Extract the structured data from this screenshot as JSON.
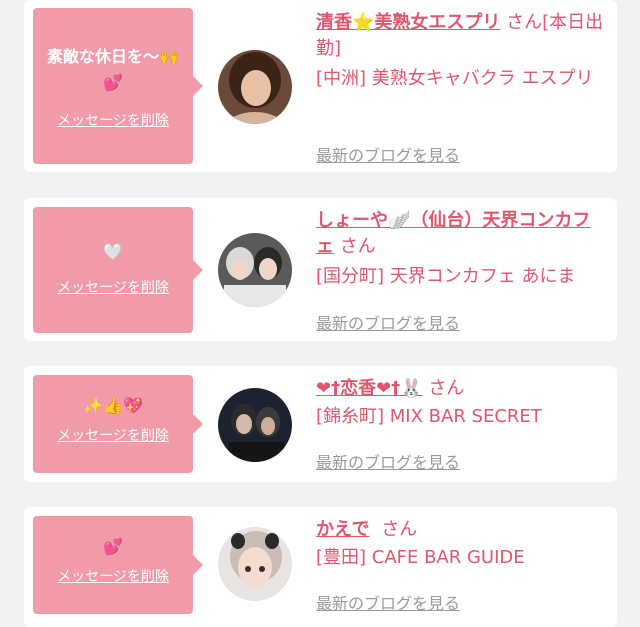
{
  "colors": {
    "accent": "#e0566e",
    "bubble": "#f19aa8",
    "muted": "#9a9a9a"
  },
  "delete_label": "メッセージを削除",
  "blog_label": "最新のブログを見る",
  "san": "さん",
  "cards": [
    {
      "message_line1": "素敵な休日を〜🙌",
      "message_line2": "💕",
      "name": "清香⭐美熟女エスプリ",
      "suffix": "[本日出勤]",
      "shop": "[中洲] 美熟女キャバクラ エスプリ"
    },
    {
      "message_line1": "🤍",
      "name": "しょーや🪽（仙台）天界コンカフェ",
      "shop": "[国分町] 天界コンカフェ あにま"
    },
    {
      "message_line1": "✨👍💖",
      "name": "❤†恋香❤†🐰",
      "shop": "[錦糸町] MIX BAR SECRET"
    },
    {
      "message_line1": "💕",
      "name": "かえで",
      "shop": "[豊田] CAFE BAR GUIDE"
    }
  ]
}
